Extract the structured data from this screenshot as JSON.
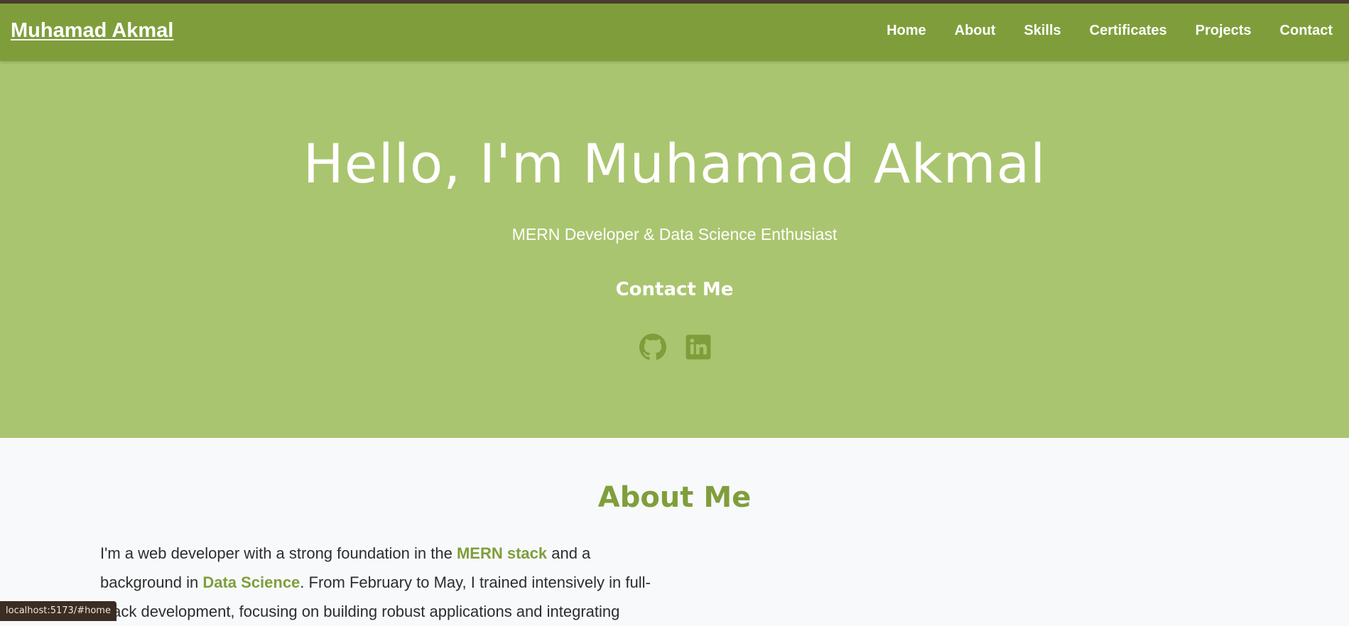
{
  "colors": {
    "top_line": "#4b3b2f",
    "navbar_bg": "#7f9e3b",
    "hero_bg": "#aac56f",
    "accent": "#7f9e3b",
    "page_bg": "#f8f9fb",
    "status_bg": "#3a2d24"
  },
  "navbar": {
    "brand": "Muhamad Akmal",
    "links": [
      {
        "label": "Home"
      },
      {
        "label": "About"
      },
      {
        "label": "Skills"
      },
      {
        "label": "Certificates"
      },
      {
        "label": "Projects"
      },
      {
        "label": "Contact"
      }
    ]
  },
  "hero": {
    "title": "Hello, I'm Muhamad Akmal",
    "subtitle": "MERN Developer & Data Science Enthusiast",
    "contact_label": "Contact Me",
    "socials": [
      {
        "icon": "github-icon"
      },
      {
        "icon": "linkedin-icon"
      }
    ]
  },
  "about": {
    "title": "About Me",
    "intro_1": "I'm a web developer with a strong foundation in the ",
    "highlight_1": "MERN stack",
    "intro_2": " and a background in ",
    "highlight_2": "Data Science",
    "intro_3": ". From February to May, I trained intensively in full-stack development, focusing on building robust applications and integrating"
  },
  "status_bar": {
    "url": "localhost:5173/#home"
  }
}
